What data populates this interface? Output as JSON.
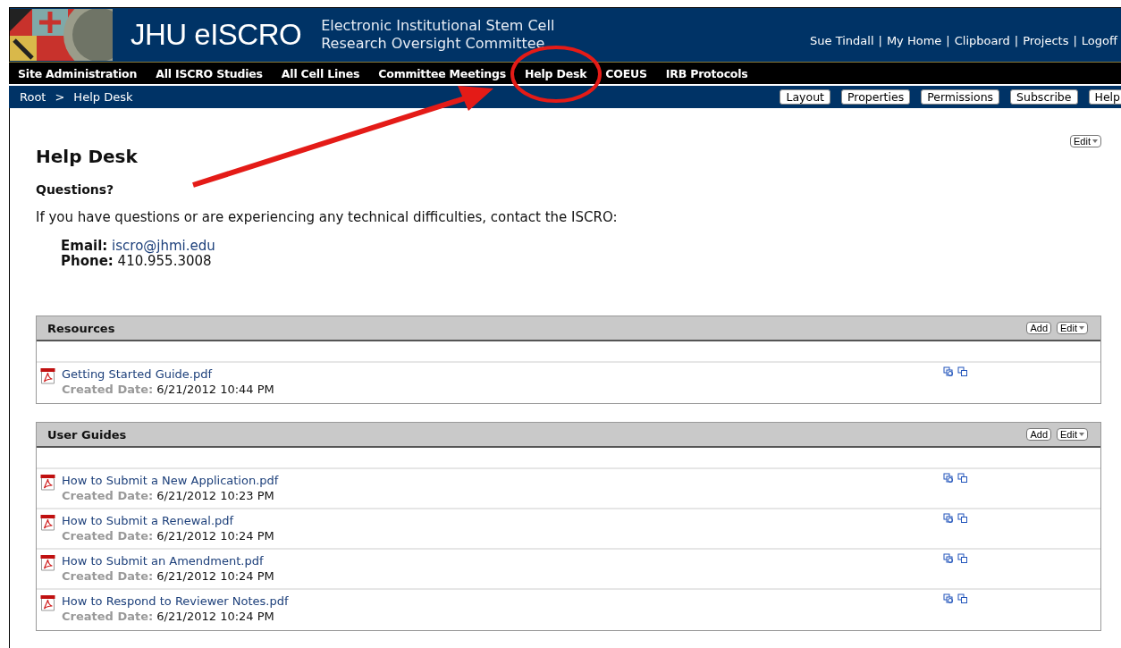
{
  "header": {
    "title": "JHU eISCRO",
    "subtitle": [
      "Electronic Institutional Stem Cell",
      "Research Oversight Committee"
    ],
    "user_links": [
      "Sue Tindall",
      "My Home",
      "Clipboard",
      "Projects",
      "Logoff"
    ],
    "separator": "|"
  },
  "nav": [
    "Site Administration",
    "All ISCRO Studies",
    "All Cell Lines",
    "Committee Meetings",
    "Help Desk",
    "COEUS",
    "IRB Protocols"
  ],
  "breadcrumb": {
    "items": [
      "Root",
      "Help Desk"
    ],
    "separator": ">"
  },
  "page_actions": [
    "Layout",
    "Properties",
    "Permissions",
    "Subscribe",
    "Help"
  ],
  "content": {
    "title": "Help Desk",
    "edit_button": "Edit",
    "heading": "Questions?",
    "paragraph": "If you have questions or are experiencing any technical difficulties, contact the ISCRO:",
    "contacts": [
      {
        "kind": "link",
        "label": "Email:",
        "value": "iscro@jhmi.edu"
      },
      {
        "kind": "text",
        "label": "Phone:",
        "value": "410.955.3008"
      }
    ]
  },
  "sections": [
    {
      "title": "Resources",
      "add_button": "Add",
      "edit_button": "Edit",
      "items": [
        {
          "name": "Getting Started Guide.pdf",
          "date_label": "Created Date:",
          "date": "6/21/2012 10:44 PM"
        }
      ]
    },
    {
      "title": "User Guides",
      "add_button": "Add",
      "edit_button": "Edit",
      "items": [
        {
          "name": "How to Submit a New Application.pdf",
          "date_label": "Created Date:",
          "date": "6/21/2012 10:23 PM"
        },
        {
          "name": "How to Submit a Renewal.pdf",
          "date_label": "Created Date:",
          "date": "6/21/2012 10:24 PM"
        },
        {
          "name": "How to Submit an Amendment.pdf",
          "date_label": "Created Date:",
          "date": "6/21/2012 10:24 PM"
        },
        {
          "name": "How to Respond to Reviewer Notes.pdf",
          "date_label": "Created Date:",
          "date": "6/21/2012 10:24 PM"
        }
      ]
    }
  ]
}
